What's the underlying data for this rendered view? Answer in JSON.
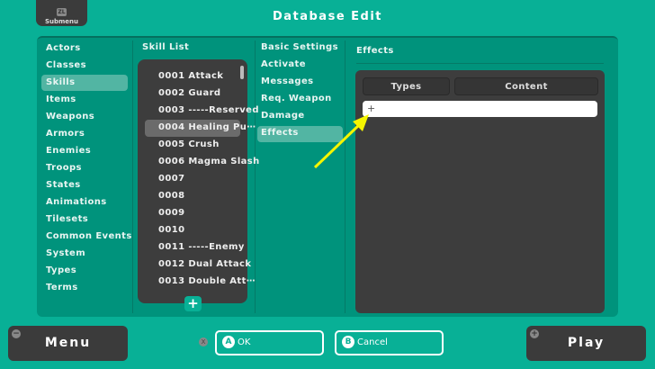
{
  "header": {
    "submenu_key": "ZL",
    "submenu_label": "Submenu",
    "title": "Database Edit"
  },
  "sidebar": {
    "items": [
      "Actors",
      "Classes",
      "Skills",
      "Items",
      "Weapons",
      "Armors",
      "Enemies",
      "Troops",
      "States",
      "Animations",
      "Tilesets",
      "Common Events",
      "System",
      "Types",
      "Terms"
    ],
    "selected": "Skills"
  },
  "skill_list": {
    "title": "Skill List",
    "items": [
      "0001 Attack",
      "0002 Guard",
      "0003 -----Reserved",
      "0004 Healing Pu⋯",
      "0005 Crush",
      "0006 Magma Slash",
      "0007",
      "0008",
      "0009",
      "0010",
      "0011 -----Enemy",
      "0012 Dual Attack",
      "0013 Double Att⋯"
    ],
    "selected_index": 3,
    "add_label": "+"
  },
  "settings": {
    "items": [
      "Basic Settings",
      "Activate",
      "Messages",
      "Req. Weapon",
      "Damage",
      "Effects"
    ],
    "selected": "Effects"
  },
  "effects": {
    "title": "Effects",
    "columns": [
      "Types",
      "Content"
    ],
    "new_row": "+"
  },
  "footer": {
    "menu": "Menu",
    "menu_key": "−",
    "play": "Play",
    "play_key": "+",
    "x_key": "X",
    "ok_key": "A",
    "ok": "OK",
    "cancel_key": "B",
    "cancel": "Cancel"
  },
  "colors": {
    "background": "#08b096",
    "panel": "#00937c",
    "dark": "#3d3d3d",
    "highlight": "#52b5a3",
    "arrow": "#f5f500"
  }
}
